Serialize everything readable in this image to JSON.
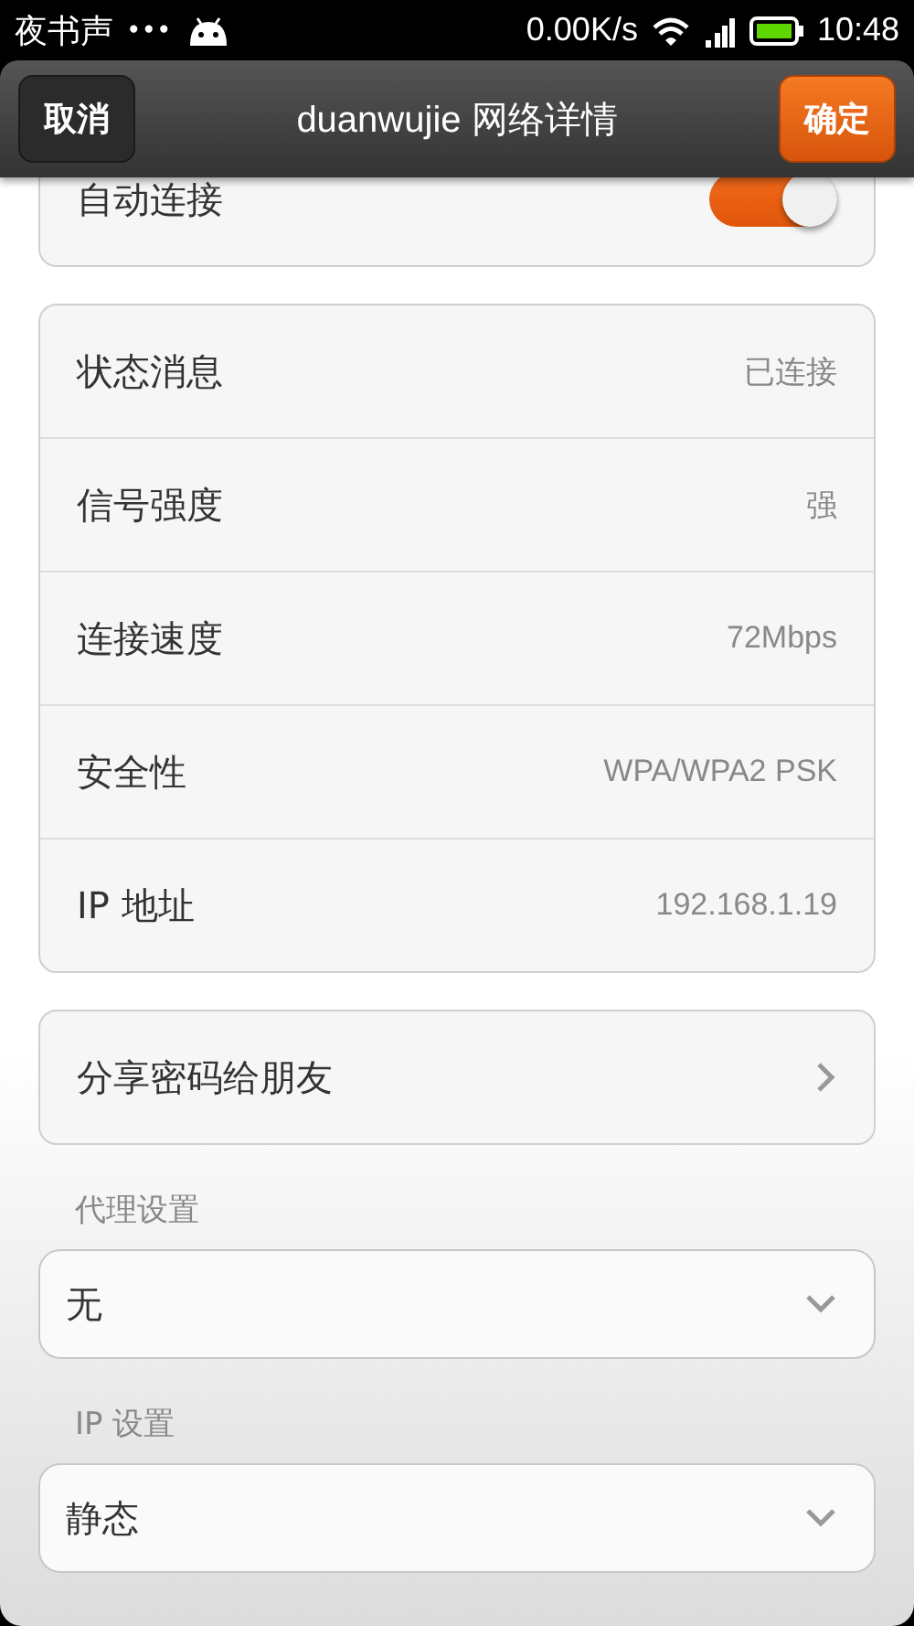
{
  "status_bar": {
    "app_name": "夜书声",
    "dots": "•••",
    "speed": "0.00K/s",
    "time": "10:48"
  },
  "header": {
    "cancel": "取消",
    "title": "duanwujie 网络详情",
    "confirm": "确定"
  },
  "auto_connect": {
    "label": "自动连接",
    "on": true
  },
  "details": [
    {
      "label": "状态消息",
      "value": "已连接"
    },
    {
      "label": "信号强度",
      "value": "强"
    },
    {
      "label": "连接速度",
      "value": "72Mbps"
    },
    {
      "label": "安全性",
      "value": "WPA/WPA2 PSK"
    },
    {
      "label": "IP 地址",
      "value": "192.168.1.19"
    }
  ],
  "share": {
    "label": "分享密码给朋友"
  },
  "settings": [
    {
      "label": "代理设置",
      "value": "无"
    },
    {
      "label": "IP 设置",
      "value": "静态"
    }
  ]
}
